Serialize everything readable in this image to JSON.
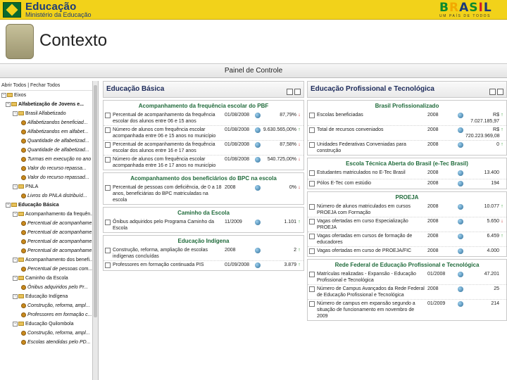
{
  "banner": {
    "title": "Educação",
    "subtitle": "Ministério da Educação",
    "brand": "BRASIL",
    "brand_tagline": "UM PAÍS DE TODOS",
    "colors": {
      "banner": "#f2d21a",
      "brand_green": "#0a8a2e",
      "brand_blue": "#1b3a7a"
    }
  },
  "slide": {
    "title": "Contexto"
  },
  "app": {
    "panel_title": "Painel de Controle",
    "tree": {
      "toolbar": "Abrir Todos | Fechar Todos",
      "items": [
        {
          "label": "Eixos",
          "kind": "root"
        },
        {
          "label": "Alfabetização de Jovens e...",
          "kind": "folder",
          "bold": true
        },
        {
          "label": "Brasil Alfabetizado",
          "kind": "folder"
        },
        {
          "label": "Alfabetizandos beneficiad...",
          "kind": "leaf"
        },
        {
          "label": "Alfabetizandos em alfabet...",
          "kind": "leaf"
        },
        {
          "label": "Quantidade de alfabetizad...",
          "kind": "leaf"
        },
        {
          "label": "Quantidade de alfabetizad...",
          "kind": "leaf"
        },
        {
          "label": "Turmas em execução no ano",
          "kind": "leaf"
        },
        {
          "label": "Valor do recurso repassa...",
          "kind": "leaf"
        },
        {
          "label": "Valor do recurso repassad...",
          "kind": "leaf"
        },
        {
          "label": "PNLA",
          "kind": "folder"
        },
        {
          "label": "Livros do PNLA distribuíd...",
          "kind": "leaf"
        },
        {
          "label": "Educação Básica",
          "kind": "folder",
          "bold": true
        },
        {
          "label": "Acompanhamento da frequên...",
          "kind": "folder"
        },
        {
          "label": "Percentual de acompanhame...",
          "kind": "leaf"
        },
        {
          "label": "Percentual de acompanhame...",
          "kind": "leaf"
        },
        {
          "label": "Percentual de acompanhame...",
          "kind": "leaf"
        },
        {
          "label": "Percentual de acompanhame...",
          "kind": "leaf"
        },
        {
          "label": "Acompanhamento dos benefi...",
          "kind": "folder"
        },
        {
          "label": "Percentual de pessoas com...",
          "kind": "leaf"
        },
        {
          "label": "Caminho da Escola",
          "kind": "folder"
        },
        {
          "label": "Ônibus adquiridos pelo Pr...",
          "kind": "leaf"
        },
        {
          "label": "Educação Indígena",
          "kind": "folder"
        },
        {
          "label": "Construção, reforma, ampl...",
          "kind": "leaf"
        },
        {
          "label": "Professores em formação c...",
          "kind": "leaf"
        },
        {
          "label": "Educação Quilombola",
          "kind": "folder"
        },
        {
          "label": "Construção, reforma, ampl...",
          "kind": "leaf"
        },
        {
          "label": "Escolas atendidas pelo PD...",
          "kind": "leaf"
        }
      ]
    },
    "mid": {
      "header": "Educação Básica",
      "widgets": [
        {
          "title": "Acompanhamento da frequência escolar do PBF",
          "rows": [
            {
              "desc": "Percentual de acompanhamento da frequência escolar dos alunos entre 06 e 15 anos",
              "date": "01/08/2008",
              "value": "87,79%",
              "trend": "down"
            },
            {
              "desc": "Número de alunos com frequência escolar acompanhada entre 06 e 15 anos no município",
              "date": "01/08/2008",
              "value": "9.630.565,00%",
              "trend": "up"
            },
            {
              "desc": "Percentual de acompanhamento da frequência escolar dos alunos entre 16 e 17 anos",
              "date": "01/08/2008",
              "value": "87,58%",
              "trend": "down"
            },
            {
              "desc": "Número de alunos com frequência escolar acompanhada entre 16 e 17 anos no município",
              "date": "01/08/2008",
              "value": "540.725,00%",
              "trend": "down"
            }
          ]
        },
        {
          "title": "Acompanhamento dos beneficiários do BPC na escola",
          "rows": [
            {
              "desc": "Percentual de pessoas com deficiência, de 0 a 18 anos, beneficiárias do BPC matriculadas na escola",
              "date": "2008",
              "value": "0%",
              "trend": "down"
            }
          ]
        },
        {
          "title": "Caminho da Escola",
          "rows": [
            {
              "desc": "Ônibus adquiridos pelo Programa Caminho da Escola",
              "date": "11/2009",
              "value": "1.101",
              "trend": "up"
            }
          ]
        },
        {
          "title": "Educação Indígena",
          "rows": [
            {
              "desc": "Construção, reforma, ampliação de escolas indígenas concluídas",
              "date": "2008",
              "value": "2",
              "trend": "up"
            },
            {
              "desc": "Professores em formação continuada PIS",
              "date": "01/09/2008",
              "value": "3.879",
              "trend": "up"
            }
          ]
        }
      ]
    },
    "right": {
      "header": "Educação Profissional e Tecnológica",
      "widgets": [
        {
          "title": "Brasil Profissionalizado",
          "rows": [
            {
              "desc": "Escolas beneficiadas",
              "date": "2008",
              "value": "R$ 7.027.185,97",
              "trend": "up"
            },
            {
              "desc": "Total de recursos conveniados",
              "date": "2008",
              "value": "R$ 720.223.969,08",
              "trend": "up"
            },
            {
              "desc": "Unidades Federativas Conveniadas para construção",
              "date": "2008",
              "value": "0",
              "trend": "up"
            }
          ]
        },
        {
          "title": "Escola Técnica Aberta do Brasil (e-Tec Brasil)",
          "rows": [
            {
              "desc": "Estudantes matriculados no E-Tec Brasil",
              "date": "2008",
              "value": "13.400",
              "trend": "none"
            },
            {
              "desc": "Pólos E-Tec com estúdio",
              "date": "2008",
              "value": "194",
              "trend": "none"
            }
          ]
        },
        {
          "title": "PROEJA",
          "rows": [
            {
              "desc": "Número de alunos matriculados em cursos PROEJA com Formação",
              "date": "2008",
              "value": "10.077",
              "trend": "up"
            },
            {
              "desc": "Vagas ofertadas em curso Especialização PROEJA",
              "date": "2008",
              "value": "5.650",
              "trend": "down"
            },
            {
              "desc": "Vagas ofertadas em cursos de formação de educadores",
              "date": "2008",
              "value": "6.459",
              "trend": "up"
            },
            {
              "desc": "Vagas ofertadas em curso de PROEJA/FIC",
              "date": "2008",
              "value": "4.000",
              "trend": "none"
            }
          ]
        },
        {
          "title": "Rede Federal de Educação Profissional e Tecnológica",
          "rows": [
            {
              "desc": "Matrículas realizadas - Expansão - Educação Profissional e Tecnológica",
              "date": "01/2008",
              "value": "47.201",
              "trend": "none"
            },
            {
              "desc": "Número de Campus Avançados da Rede Federal de Educação Profissional e Tecnológica",
              "date": "2008",
              "value": "25",
              "trend": "none"
            },
            {
              "desc": "Número de campus em expansão segundo a situação de funcionamento em novembro de 2009",
              "date": "01/2009",
              "value": "214",
              "trend": "none"
            }
          ]
        }
      ]
    }
  }
}
